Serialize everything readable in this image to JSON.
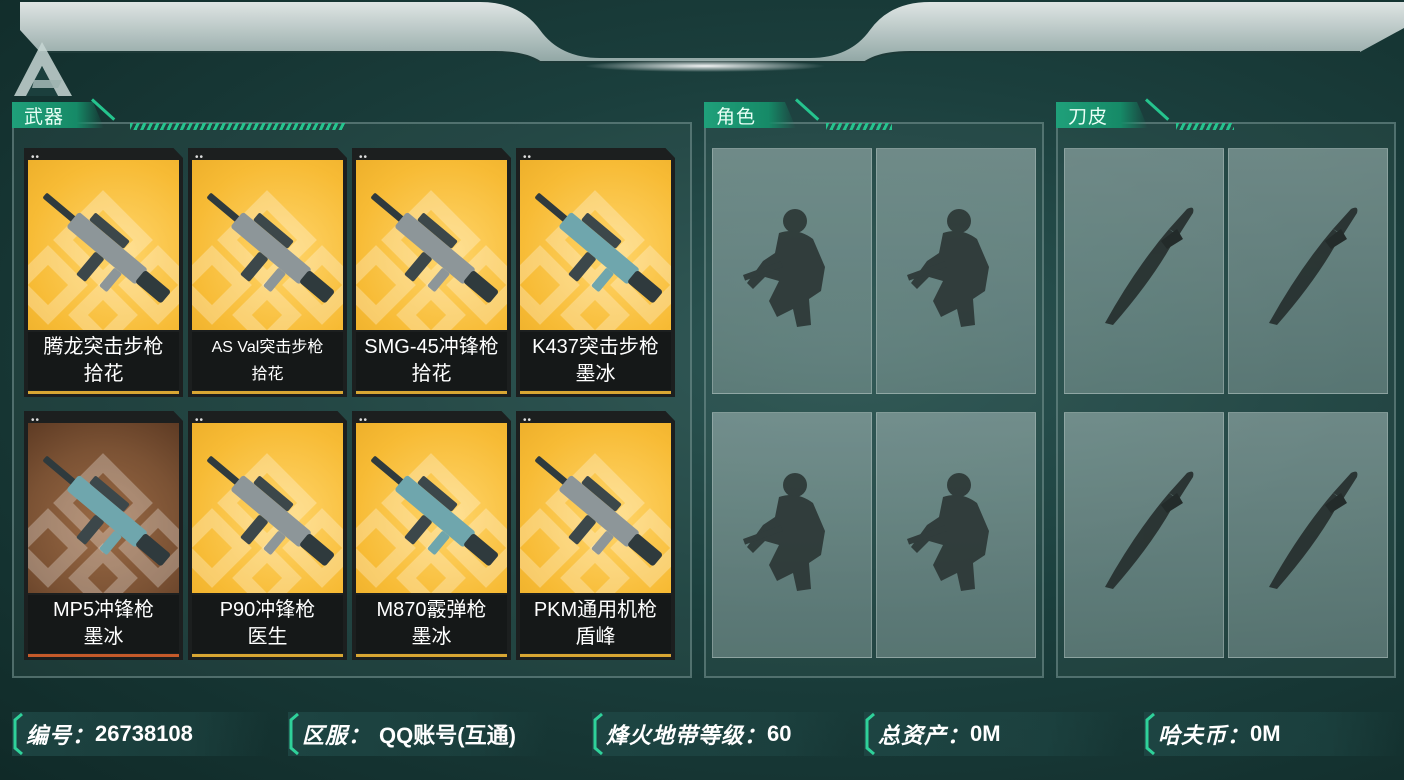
{
  "sections": {
    "weapons": "武器",
    "characters": "角色",
    "knife_skins": "刀皮"
  },
  "weapons": [
    {
      "name": "腾龙突击步枪",
      "skin": "拾花",
      "style": "gold"
    },
    {
      "name": "AS Val突击步枪",
      "skin": "拾花",
      "style": "gold"
    },
    {
      "name": "SMG-45冲锋枪",
      "skin": "拾花",
      "style": "gold"
    },
    {
      "name": "K437突击步枪",
      "skin": "墨冰",
      "style": "gold"
    },
    {
      "name": "MP5冲锋枪",
      "skin": "墨冰",
      "style": "brown"
    },
    {
      "name": "P90冲锋枪",
      "skin": "医生",
      "style": "gold"
    },
    {
      "name": "M870霰弹枪",
      "skin": "墨冰",
      "style": "gold"
    },
    {
      "name": "PKM通用机枪",
      "skin": "盾峰",
      "style": "gold"
    }
  ],
  "footer": {
    "id_label": "编号：",
    "id_value": "26738108",
    "server_label": "区服：",
    "server_value": "QQ账号(互通)",
    "level_label": "烽火地带等级：",
    "level_value": "60",
    "assets_label": "总资产：",
    "assets_value": "0M",
    "coin_label": "哈夫币：",
    "coin_value": "0M"
  },
  "icons": {
    "logo": "delta-logo-icon",
    "character": "soldier-silhouette-icon",
    "knife": "knife-silhouette-icon"
  },
  "colors": {
    "accent": "#1fa07a",
    "gold_card": "#f7bb35",
    "brown_card": "#7b5234"
  }
}
